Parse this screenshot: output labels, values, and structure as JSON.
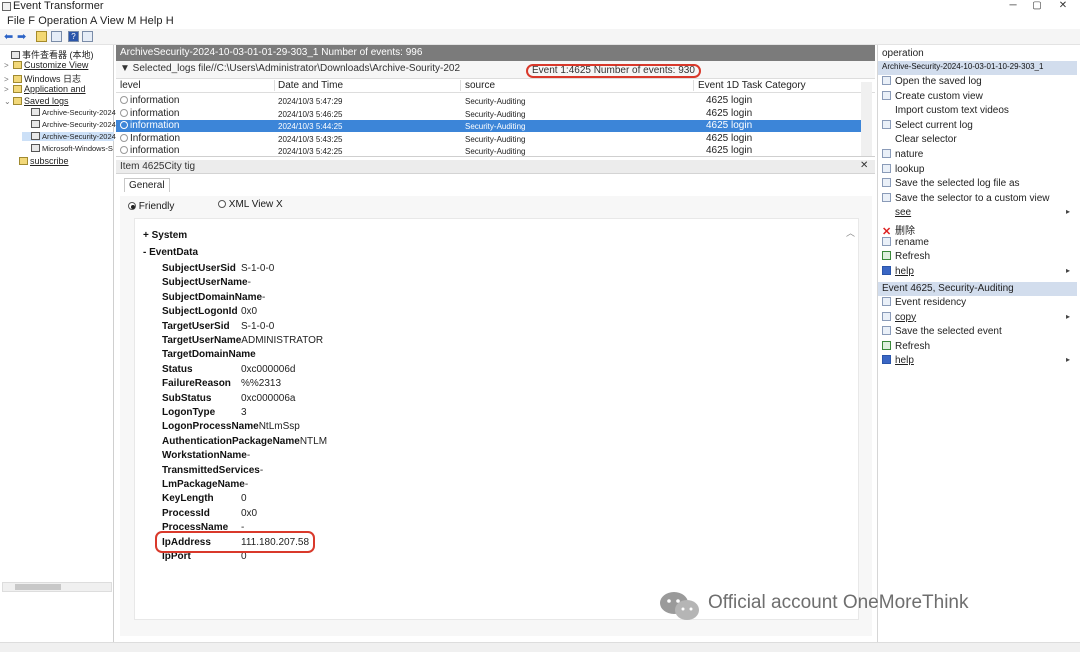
{
  "window": {
    "title": "Event Transformer",
    "controls": [
      "─",
      "▢",
      "✕"
    ]
  },
  "menu": {
    "text": "File F Operation A View M Help H"
  },
  "toolbar": {
    "icons": [
      "back-arrow-icon",
      "forward-arrow-icon",
      "folder-icon",
      "panel-icon",
      "help-icon",
      "properties-icon"
    ]
  },
  "tree": {
    "nodes": [
      {
        "label": "事件查看器 (本地)",
        "toggle": "",
        "icon": "log"
      },
      {
        "label": "Customize View",
        "toggle": ">",
        "icon": "folder",
        "underline": true
      },
      {
        "label": "Windows 日志",
        "toggle": ">",
        "icon": "folder"
      },
      {
        "label": "Application and",
        "toggle": ">",
        "icon": "folder",
        "underline": true
      },
      {
        "label": "Saved logs",
        "toggle": "⌄",
        "icon": "folder",
        "underline": true
      },
      {
        "label": "Archive-Security-2024",
        "toggle": "",
        "icon": "log"
      },
      {
        "label": "Archive-Security-2024",
        "toggle": "",
        "icon": "log"
      },
      {
        "label": "Archive-Security-2024",
        "toggle": "",
        "icon": "log",
        "selected": true
      },
      {
        "label": "Microsoft-Windows-S",
        "toggle": "",
        "icon": "log"
      },
      {
        "label": "subscribe",
        "toggle": "",
        "icon": "folder",
        "underline": true
      }
    ]
  },
  "center": {
    "title": "ArchiveSecurity-2024-10-03-01-01-29-303_1 Number of events: 996",
    "filter_text": "▼  Selected_logs file//C:\\Users\\Administrator\\Downloads\\Archive-Sourity-202",
    "filter_count": "Event 1:4625 Number of events: 930"
  },
  "event_list": {
    "columns": [
      "level",
      "Date and Time",
      "source",
      "Event 1D Task Category"
    ],
    "rows": [
      {
        "level": "information",
        "datetime": "2024/10/3 5:47:29",
        "source": "Security-Auditing",
        "event": "4625 login",
        "selected": false
      },
      {
        "level": "information",
        "datetime": "2024/10/3 5:46:25",
        "source": "Security-Auditing",
        "event": "4625 login",
        "selected": false
      },
      {
        "level": "information",
        "datetime": "2024/10/3 5:44:25",
        "source": "Security-Auditing",
        "event": "4625 login",
        "selected": true
      },
      {
        "level": "Information",
        "datetime": "2024/10/3 5:43:25",
        "source": "Security-Auditing",
        "event": "4625 login",
        "selected": false
      },
      {
        "level": "information",
        "datetime": "2024/10/3 5:42:25",
        "source": "Security-Auditing",
        "event": "4625 login",
        "selected": false
      }
    ]
  },
  "detail": {
    "header": "Item 4625City tig",
    "close": "✕",
    "tab": "General",
    "view_friendly": "Friendly",
    "view_xml": "XML View X",
    "system_label": "+ System",
    "eventdata_label": "-  EventData",
    "fields": [
      {
        "key": "SubjectUserSid",
        "value": "S-1-0-0"
      },
      {
        "key": "SubjectUserName",
        "value": "-"
      },
      {
        "key": "SubjectDomainName",
        "value": "-"
      },
      {
        "key": "SubjectLogonId",
        "value": "0x0"
      },
      {
        "key": "TargetUserSid",
        "value": "S-1-0-0"
      },
      {
        "key": "TargetUserName",
        "value": "ADMINISTRATOR"
      },
      {
        "key": "TargetDomainName",
        "value": ""
      },
      {
        "key": "Status",
        "value": "0xc000006d"
      },
      {
        "key": "FailureReason",
        "value": "%%2313"
      },
      {
        "key": "SubStatus",
        "value": "0xc000006a"
      },
      {
        "key": "LogonType",
        "value": "3"
      },
      {
        "key": "LogonProcessName",
        "value": "NtLmSsp"
      },
      {
        "key": "AuthenticationPackageName",
        "value": "NTLM"
      },
      {
        "key": "WorkstationName",
        "value": "-"
      },
      {
        "key": "TransmittedServices",
        "value": "-"
      },
      {
        "key": "LmPackageName",
        "value": "-"
      },
      {
        "key": "KeyLength",
        "value": "0"
      },
      {
        "key": "ProcessId",
        "value": "0x0"
      },
      {
        "key": "ProcessName",
        "value": "-"
      },
      {
        "key": "IpAddress",
        "value": "111.180.207.58"
      },
      {
        "key": "IpPort",
        "value": "0"
      }
    ]
  },
  "actions": {
    "header": "operation",
    "log_section": "Archive-Security-2024-10-03-01-10-29-303_1",
    "log_items": [
      {
        "label": "Open the saved log",
        "icon": "folder-icon",
        "arrow": ""
      },
      {
        "label": "Create custom view",
        "icon": "filter-icon",
        "arrow": ""
      },
      {
        "label": "Import custom text videos",
        "icon": "",
        "arrow": ""
      },
      {
        "label": "Select current log",
        "icon": "filter-icon",
        "arrow": ""
      },
      {
        "label": "Clear selector",
        "icon": "",
        "arrow": ""
      },
      {
        "label": "nature",
        "icon": "properties-icon",
        "arrow": ""
      },
      {
        "label": "lookup",
        "icon": "binoculars-icon",
        "arrow": ""
      },
      {
        "label": "Save the selected log file as",
        "icon": "save-icon",
        "arrow": ""
      },
      {
        "label": "Save the selector to a custom view",
        "icon": "save-filter-icon",
        "arrow": ""
      },
      {
        "label": "see",
        "icon": "",
        "arrow": "▸",
        "underline": true
      },
      {
        "label": "删除",
        "icon": "delete-icon",
        "arrow": ""
      },
      {
        "label": "rename",
        "icon": "rename-icon",
        "arrow": ""
      },
      {
        "label": "Refresh",
        "icon": "refresh-icon",
        "arrow": ""
      },
      {
        "label": "help",
        "icon": "help-icon",
        "arrow": "▸",
        "underline": true
      }
    ],
    "event_section": "Event 4625, Security-Auditing",
    "event_items": [
      {
        "label": "Event residency",
        "icon": "properties-icon",
        "arrow": ""
      },
      {
        "label": "copy",
        "icon": "copy-icon",
        "arrow": "▸",
        "underline": true
      },
      {
        "label": "Save the selected event",
        "icon": "save-icon",
        "arrow": ""
      },
      {
        "label": "Refresh",
        "icon": "refresh-icon",
        "arrow": ""
      },
      {
        "label": "help",
        "icon": "help-icon",
        "arrow": "▸",
        "underline": true
      }
    ]
  },
  "watermark": {
    "text": "Official account OneMoreThink",
    "icon": "wechat-icon"
  },
  "colors": {
    "selection": "#3c85d8",
    "highlight_red": "#d9392b",
    "section_blue": "#d2dded",
    "title_gray": "#7b7b7b"
  }
}
